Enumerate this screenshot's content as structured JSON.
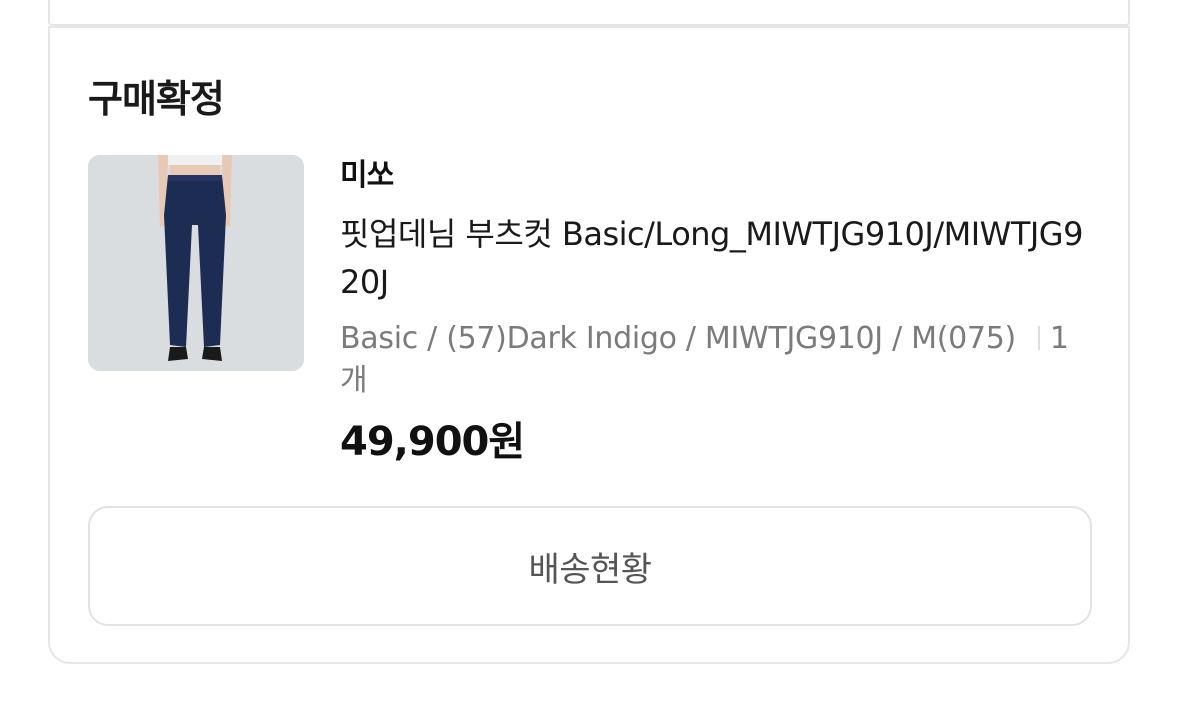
{
  "order": {
    "status": "구매확정",
    "item": {
      "brand": "미쏘",
      "product_name": "핏업데님 부츠컷 Basic/Long_MIWTJG910J/MIWTJG920J",
      "option": "Basic / (57)Dark Indigo / MIWTJG910J / M(075)",
      "quantity": "1개",
      "price": "49,900원",
      "image": "product-thumbnail-jeans"
    },
    "track_button_label": "배송현황"
  }
}
